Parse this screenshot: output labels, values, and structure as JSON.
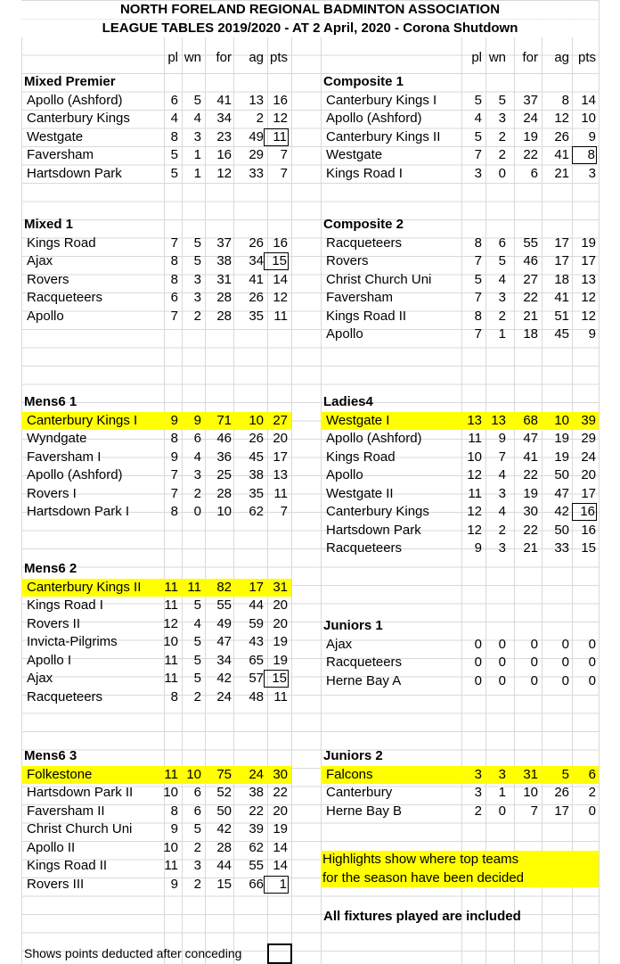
{
  "header": {
    "line1": "NORTH FORELAND REGIONAL BADMINTON ASSOCIATION",
    "line2": "LEAGUE TABLES 2019/2020 - AT 2 April, 2020 - Corona Shutdown"
  },
  "columns": [
    "pl",
    "wn",
    "for",
    "ag",
    "pts"
  ],
  "left": [
    {
      "title": "Mixed Premier",
      "rows": [
        {
          "team": "Apollo (Ashford)",
          "pl": "6",
          "wn": "5",
          "for": "41",
          "ag": "13",
          "pts": "16"
        },
        {
          "team": "Canterbury Kings",
          "pl": "4",
          "wn": "4",
          "for": "34",
          "ag": "2",
          "pts": "12"
        },
        {
          "team": "Westgate",
          "pl": "8",
          "wn": "3",
          "for": "23",
          "ag": "49",
          "pts": "11",
          "boxed": true
        },
        {
          "team": "Faversham",
          "pl": "5",
          "wn": "1",
          "for": "16",
          "ag": "29",
          "pts": "7"
        },
        {
          "team": "Hartsdown Park",
          "pl": "5",
          "wn": "1",
          "for": "12",
          "ag": "33",
          "pts": "7"
        }
      ]
    },
    {
      "title": "Mixed 1",
      "rows": [
        {
          "team": "Kings Road",
          "pl": "7",
          "wn": "5",
          "for": "37",
          "ag": "26",
          "pts": "16"
        },
        {
          "team": "Ajax",
          "pl": "8",
          "wn": "5",
          "for": "38",
          "ag": "34",
          "pts": "15",
          "boxed": true
        },
        {
          "team": "Rovers",
          "pl": "8",
          "wn": "3",
          "for": "31",
          "ag": "41",
          "pts": "14"
        },
        {
          "team": "Racqueteers",
          "pl": "6",
          "wn": "3",
          "for": "28",
          "ag": "26",
          "pts": "12"
        },
        {
          "team": "Apollo",
          "pl": "7",
          "wn": "2",
          "for": "28",
          "ag": "35",
          "pts": "11"
        }
      ]
    },
    {
      "title": "Mens6 1",
      "rows": [
        {
          "team": "Canterbury Kings I",
          "pl": "9",
          "wn": "9",
          "for": "71",
          "ag": "10",
          "pts": "27",
          "highlight": true
        },
        {
          "team": "Wyndgate",
          "pl": "8",
          "wn": "6",
          "for": "46",
          "ag": "26",
          "pts": "20"
        },
        {
          "team": "Faversham I",
          "pl": "9",
          "wn": "4",
          "for": "36",
          "ag": "45",
          "pts": "17"
        },
        {
          "team": "Apollo (Ashford)",
          "pl": "7",
          "wn": "3",
          "for": "25",
          "ag": "38",
          "pts": "13"
        },
        {
          "team": "Rovers I",
          "pl": "7",
          "wn": "2",
          "for": "28",
          "ag": "35",
          "pts": "11"
        },
        {
          "team": "Hartsdown Park I",
          "pl": "8",
          "wn": "0",
          "for": "10",
          "ag": "62",
          "pts": "7"
        }
      ]
    },
    {
      "title": "Mens6 2",
      "rows": [
        {
          "team": "Canterbury Kings II",
          "pl": "11",
          "wn": "11",
          "for": "82",
          "ag": "17",
          "pts": "31",
          "highlight": true
        },
        {
          "team": "Kings Road I",
          "pl": "11",
          "wn": "5",
          "for": "55",
          "ag": "44",
          "pts": "20"
        },
        {
          "team": "Rovers II",
          "pl": "12",
          "wn": "4",
          "for": "49",
          "ag": "59",
          "pts": "20"
        },
        {
          "team": "Invicta-Pilgrims",
          "pl": "10",
          "wn": "5",
          "for": "47",
          "ag": "43",
          "pts": "19"
        },
        {
          "team": "Apollo I",
          "pl": "11",
          "wn": "5",
          "for": "34",
          "ag": "65",
          "pts": "19"
        },
        {
          "team": "Ajax",
          "pl": "11",
          "wn": "5",
          "for": "42",
          "ag": "57",
          "pts": "15",
          "boxed": true
        },
        {
          "team": "Racqueteers",
          "pl": "8",
          "wn": "2",
          "for": "24",
          "ag": "48",
          "pts": "11"
        }
      ]
    },
    {
      "title": "Mens6 3",
      "rows": [
        {
          "team": "Folkestone",
          "pl": "11",
          "wn": "10",
          "for": "75",
          "ag": "24",
          "pts": "30",
          "highlight": true
        },
        {
          "team": "Hartsdown Park II",
          "pl": "10",
          "wn": "6",
          "for": "52",
          "ag": "38",
          "pts": "22"
        },
        {
          "team": "Faversham II",
          "pl": "8",
          "wn": "6",
          "for": "50",
          "ag": "22",
          "pts": "20"
        },
        {
          "team": "Christ Church Uni",
          "pl": "9",
          "wn": "5",
          "for": "42",
          "ag": "39",
          "pts": "19"
        },
        {
          "team": "Apollo II",
          "pl": "10",
          "wn": "2",
          "for": "28",
          "ag": "62",
          "pts": "14"
        },
        {
          "team": "Kings Road II",
          "pl": "11",
          "wn": "3",
          "for": "44",
          "ag": "55",
          "pts": "14"
        },
        {
          "team": "Rovers III",
          "pl": "9",
          "wn": "2",
          "for": "15",
          "ag": "66",
          "pts": "1",
          "boxed": true
        }
      ]
    }
  ],
  "right": [
    {
      "title": "Composite 1",
      "rows": [
        {
          "team": "Canterbury Kings I",
          "pl": "5",
          "wn": "5",
          "for": "37",
          "ag": "8",
          "pts": "14"
        },
        {
          "team": "Apollo (Ashford)",
          "pl": "4",
          "wn": "3",
          "for": "24",
          "ag": "12",
          "pts": "10"
        },
        {
          "team": "Canterbury Kings II",
          "pl": "5",
          "wn": "2",
          "for": "19",
          "ag": "26",
          "pts": "9"
        },
        {
          "team": "Westgate",
          "pl": "7",
          "wn": "2",
          "for": "22",
          "ag": "41",
          "pts": "8",
          "boxed": true
        },
        {
          "team": "Kings Road I",
          "pl": "3",
          "wn": "0",
          "for": "6",
          "ag": "21",
          "pts": "3"
        }
      ]
    },
    {
      "title": "Composite 2",
      "rows": [
        {
          "team": "Racqueteers",
          "pl": "8",
          "wn": "6",
          "for": "55",
          "ag": "17",
          "pts": "19"
        },
        {
          "team": "Rovers",
          "pl": "7",
          "wn": "5",
          "for": "46",
          "ag": "17",
          "pts": "17"
        },
        {
          "team": "Christ Church Uni",
          "pl": "5",
          "wn": "4",
          "for": "27",
          "ag": "18",
          "pts": "13"
        },
        {
          "team": "Faversham",
          "pl": "7",
          "wn": "3",
          "for": "22",
          "ag": "41",
          "pts": "12"
        },
        {
          "team": "Kings Road II",
          "pl": "8",
          "wn": "2",
          "for": "21",
          "ag": "51",
          "pts": "12"
        },
        {
          "team": "Apollo",
          "pl": "7",
          "wn": "1",
          "for": "18",
          "ag": "45",
          "pts": "9"
        }
      ]
    },
    {
      "title": "Ladies4",
      "rows": [
        {
          "team": "Westgate I",
          "pl": "13",
          "wn": "13",
          "for": "68",
          "ag": "10",
          "pts": "39",
          "highlight": true
        },
        {
          "team": "Apollo (Ashford)",
          "pl": "11",
          "wn": "9",
          "for": "47",
          "ag": "19",
          "pts": "29"
        },
        {
          "team": "Kings Road",
          "pl": "10",
          "wn": "7",
          "for": "41",
          "ag": "19",
          "pts": "24"
        },
        {
          "team": "Apollo",
          "pl": "12",
          "wn": "4",
          "for": "22",
          "ag": "50",
          "pts": "20"
        },
        {
          "team": "Westgate II",
          "pl": "11",
          "wn": "3",
          "for": "19",
          "ag": "47",
          "pts": "17"
        },
        {
          "team": "Canterbury Kings",
          "pl": "12",
          "wn": "4",
          "for": "30",
          "ag": "42",
          "pts": "16",
          "boxed": true
        },
        {
          "team": "Hartsdown Park",
          "pl": "12",
          "wn": "2",
          "for": "22",
          "ag": "50",
          "pts": "16"
        },
        {
          "team": "Racqueteers",
          "pl": "9",
          "wn": "3",
          "for": "21",
          "ag": "33",
          "pts": "15"
        }
      ]
    },
    {
      "title": "Juniors 1",
      "rows": [
        {
          "team": "Ajax",
          "pl": "0",
          "wn": "0",
          "for": "0",
          "ag": "0",
          "pts": "0"
        },
        {
          "team": "Racqueteers",
          "pl": "0",
          "wn": "0",
          "for": "0",
          "ag": "0",
          "pts": "0"
        },
        {
          "team": "Herne Bay A",
          "pl": "0",
          "wn": "0",
          "for": "0",
          "ag": "0",
          "pts": "0"
        }
      ]
    },
    {
      "title": "Juniors 2",
      "rows": [
        {
          "team": "Falcons",
          "pl": "3",
          "wn": "3",
          "for": "31",
          "ag": "5",
          "pts": "6",
          "highlight": true
        },
        {
          "team": "Canterbury",
          "pl": "3",
          "wn": "1",
          "for": "10",
          "ag": "26",
          "pts": "2"
        },
        {
          "team": "Herne Bay B",
          "pl": "2",
          "wn": "0",
          "for": "7",
          "ag": "17",
          "pts": "0"
        }
      ]
    }
  ],
  "notes": {
    "highlight_line1": "Highlights show where top teams",
    "highlight_line2": "for the season have been decided",
    "fixtures": "All fixtures played are included",
    "deducted": "Shows points deducted after conceding"
  },
  "colors": {
    "highlight": "#ffff00",
    "grid": "#d9d9d9"
  }
}
